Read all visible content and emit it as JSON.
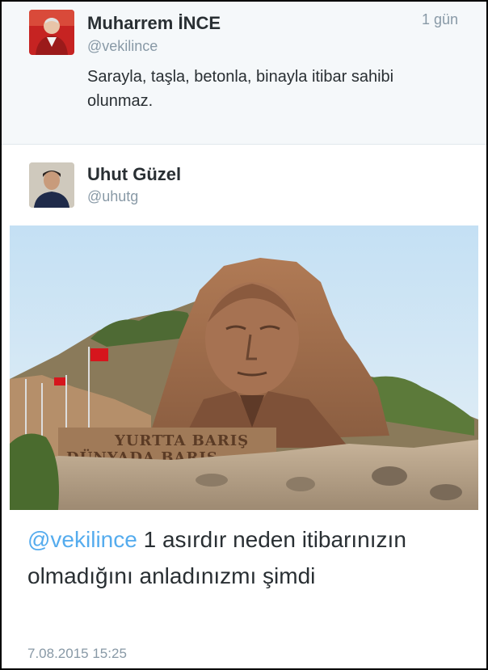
{
  "tweets": [
    {
      "name": "Muharrem İNCE",
      "handle": "@vekilince",
      "time": "1 gün",
      "text": "Sarayla, taşla, betonla, binayla itibar sahibi olunmaz."
    },
    {
      "name": "Uhut Güzel",
      "handle": "@uhutg",
      "mention": "@vekilince",
      "text": " 1 asırdır neden itibarınızın olmadığını anladınızmı şimdi",
      "timestamp": "7.08.2015 15:25",
      "photo": {
        "inscription_line1": "YURTTA BARIŞ",
        "inscription_line2": "DÜNYADA BARIŞ"
      }
    }
  ]
}
